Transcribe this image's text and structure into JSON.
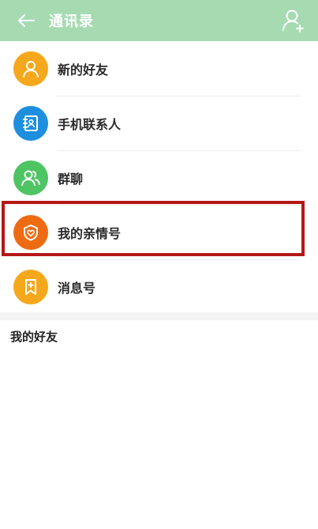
{
  "header": {
    "title": "通讯录"
  },
  "menu": {
    "items": [
      {
        "label": "新的好友",
        "icon": "person-icon",
        "color": "#f6a81c"
      },
      {
        "label": "手机联系人",
        "icon": "contact-book-icon",
        "color": "#1e8fdf"
      },
      {
        "label": "群聊",
        "icon": "group-icon",
        "color": "#4ec463"
      },
      {
        "label": "我的亲情号",
        "icon": "shield-heart-icon",
        "color": "#ef6b12"
      },
      {
        "label": "消息号",
        "icon": "bookmark-plus-icon",
        "color": "#f6a81c"
      }
    ]
  },
  "friends_section": {
    "title": "我的好友"
  },
  "colors": {
    "header_bg": "#a6dbb2",
    "highlight_border": "#b51818"
  }
}
